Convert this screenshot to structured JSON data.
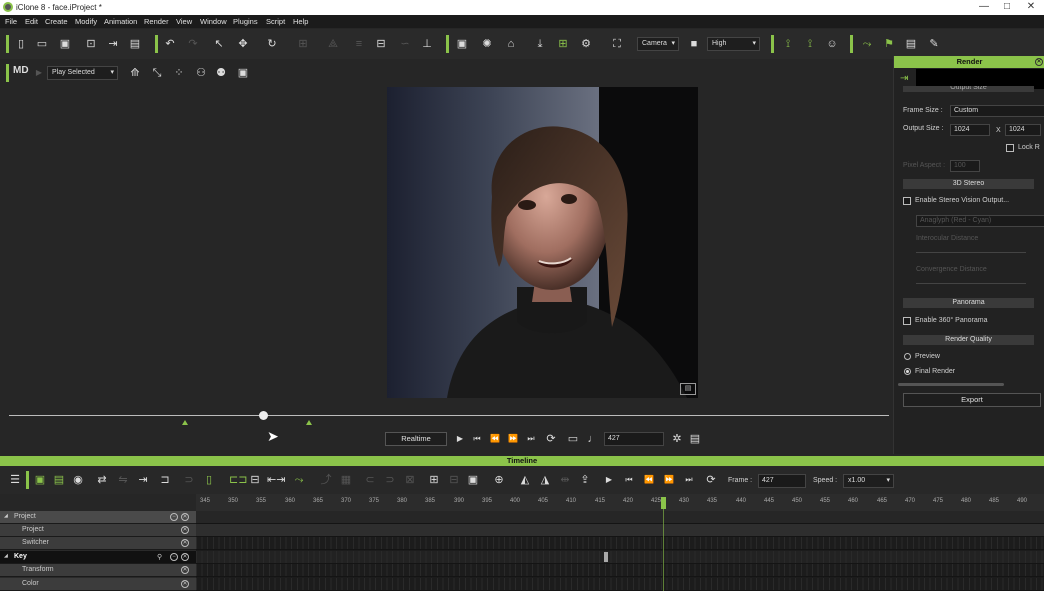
{
  "window": {
    "title": "iClone 8 - face.iProject *",
    "controls": [
      "—",
      "□",
      "✕"
    ]
  },
  "menu": [
    "File",
    "Edit",
    "Create",
    "Modify",
    "Animation",
    "Render",
    "View",
    "Window",
    "Plugins",
    "Script",
    "Help"
  ],
  "toolbar1": {
    "camera_select": "Camera",
    "quality_select": "High"
  },
  "toolbar2": {
    "logo": "MD",
    "play_mode": "Play Selected"
  },
  "playbar": {
    "mode_button": "Realtime",
    "frame_value": "427"
  },
  "render_panel": {
    "title": "Render",
    "output_size_heading": "Output Size",
    "frame_size_label": "Frame Size :",
    "frame_size_value": "Custom",
    "output_size_label": "Output Size :",
    "width": "1024",
    "x_label": "X",
    "height": "1024",
    "lock_ratio_label": "Lock R",
    "pixel_aspect_label": "Pixel Aspect :",
    "pixel_aspect_value": "100",
    "stereo_heading": "3D Stereo",
    "stereo_enable": "Enable Stereo Vision Output...",
    "stereo_mode": "Anaglyph (Red - Cyan)",
    "interocular_label": "Interocular Distance",
    "convergence_label": "Convergence Distance",
    "panorama_heading": "Panorama",
    "panorama_enable": "Enable 360° Panorama",
    "quality_heading": "Render Quality",
    "preview_label": "Preview",
    "final_render_label": "Final Render",
    "export_button": "Export"
  },
  "timeline": {
    "title": "Timeline",
    "frame_label": "Frame :",
    "frame_value": "427",
    "speed_label": "Speed :",
    "speed_value": "x1.00",
    "ruler_ticks": [
      "345",
      "350",
      "355",
      "360",
      "365",
      "370",
      "375",
      "380",
      "385",
      "390",
      "395",
      "400",
      "405",
      "410",
      "415",
      "420",
      "425",
      "430",
      "435",
      "440",
      "445",
      "450",
      "455",
      "460",
      "465",
      "470",
      "475",
      "480",
      "485",
      "490"
    ],
    "tracks": [
      {
        "label": "Project",
        "level": 0
      },
      {
        "label": "Project",
        "level": 1
      },
      {
        "label": "Switcher",
        "level": 1
      },
      {
        "label": "Key",
        "level": 0
      },
      {
        "label": "Transform",
        "level": 1
      },
      {
        "label": "Color",
        "level": 1
      }
    ]
  }
}
